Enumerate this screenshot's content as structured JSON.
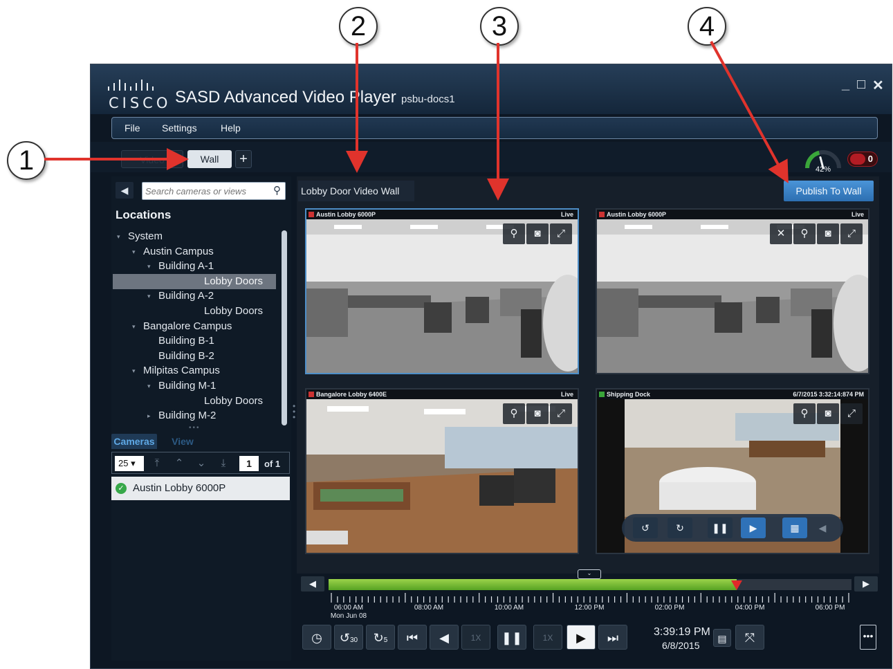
{
  "callouts": [
    "1",
    "2",
    "3",
    "4"
  ],
  "window": {
    "logo_text": "CISCO",
    "title": "SASD Advanced Video Player",
    "server": "psbu-docs1",
    "controls": {
      "minimize": "_",
      "maximize": "□",
      "close": "✕"
    }
  },
  "menu": [
    "File",
    "Settings",
    "Help"
  ],
  "tabs": {
    "video": "Video",
    "wall": "Wall",
    "add": "+"
  },
  "status": {
    "health_percent": "42%",
    "health_value": 0.42,
    "alert_count": "0"
  },
  "sidebar": {
    "collapse": "◀",
    "search_placeholder": "Search cameras or views",
    "locations_title": "Locations",
    "tree": [
      {
        "label": "System",
        "level": 0,
        "expand": "▾"
      },
      {
        "label": "Austin Campus",
        "level": 1,
        "expand": "▾"
      },
      {
        "label": "Building A-1",
        "level": 2,
        "expand": "▾"
      },
      {
        "label": "Lobby Doors",
        "level": 3,
        "selected": true
      },
      {
        "label": "Building A-2",
        "level": 2,
        "expand": "▾"
      },
      {
        "label": "Lobby Doors",
        "level": 3
      },
      {
        "label": "Bangalore Campus",
        "level": 1,
        "expand": "▾"
      },
      {
        "label": "Building B-1",
        "level": 2
      },
      {
        "label": "Building B-2",
        "level": 2
      },
      {
        "label": "Milpitas Campus",
        "level": 1,
        "expand": "▾"
      },
      {
        "label": "Building M-1",
        "level": 2,
        "expand": "▾"
      },
      {
        "label": "Lobby Doors",
        "level": 3
      },
      {
        "label": "Building M-2",
        "level": 2,
        "expand": "▸"
      }
    ],
    "tab_cameras": "Cameras",
    "tab_view": "View",
    "page_size": "25 ▾",
    "page_number": "1",
    "page_of": "of 1",
    "camera_list": [
      {
        "name": "Austin Lobby 6000P",
        "status": "ok"
      }
    ]
  },
  "wall": {
    "selector": "Lobby Door Video Wall",
    "publish_label": "Publish To Wall",
    "tiles": [
      {
        "name": "Austin Lobby 6000P",
        "state": "Live"
      },
      {
        "name": "Austin Lobby 6000P",
        "state": "Live"
      },
      {
        "name": "Bangalore Lobby 6400E",
        "state": "Live"
      },
      {
        "name": "Shipping Dock",
        "state": "6/7/2015 3:32:14:874 PM"
      }
    ]
  },
  "timeline": {
    "labels": [
      "06:00 AM",
      "08:00 AM",
      "10:00 AM",
      "12:00 PM",
      "02:00 PM",
      "04:00 PM",
      "06:00 PM"
    ],
    "first_date": "Mon Jun 08"
  },
  "playback": {
    "skip_back": "30",
    "skip_fwd": "5",
    "speed_back": "1X",
    "speed_fwd": "1X",
    "time": "3:39:19 PM",
    "date": "6/8/2015"
  },
  "more": "•••",
  "colors": {
    "accent": "#4a94d8",
    "timeline": "#6dbb2c",
    "alert": "#b21c24",
    "marker": "#e02a2a"
  }
}
